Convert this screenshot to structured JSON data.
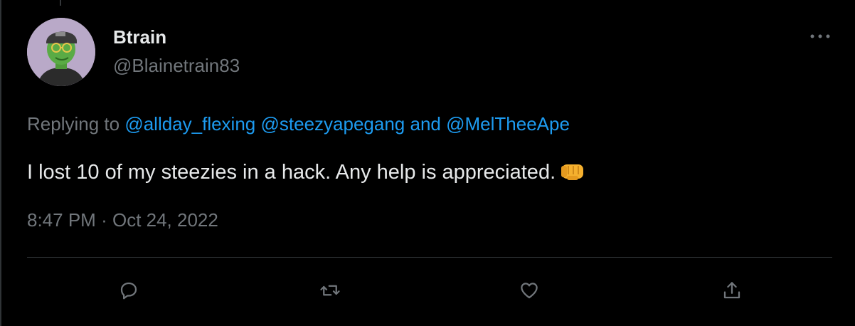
{
  "author": {
    "display_name": "Btrain",
    "handle": "@Blainetrain83",
    "avatar_icon": "avatar-ape-icon"
  },
  "reply": {
    "prefix": "Replying to ",
    "mentions": [
      "@allday_flexing",
      "@steezyapegang",
      "@MelTheeApe"
    ],
    "conjunction": "and"
  },
  "tweet": {
    "text": "I lost 10 of my steezies in a hack. Any help is appreciated.",
    "emoji_icon": "fist-bump-icon",
    "time": "8:47 PM",
    "separator": "·",
    "date": "Oct 24, 2022"
  },
  "actions": {
    "more_icon": "more-icon",
    "reply_icon": "reply-icon",
    "retweet_icon": "retweet-icon",
    "like_icon": "like-icon",
    "share_icon": "share-icon"
  },
  "colors": {
    "background": "#000000",
    "text": "#e7e9ea",
    "secondary": "#71767b",
    "accent": "#1d9bf0",
    "divider": "#2f3336"
  }
}
